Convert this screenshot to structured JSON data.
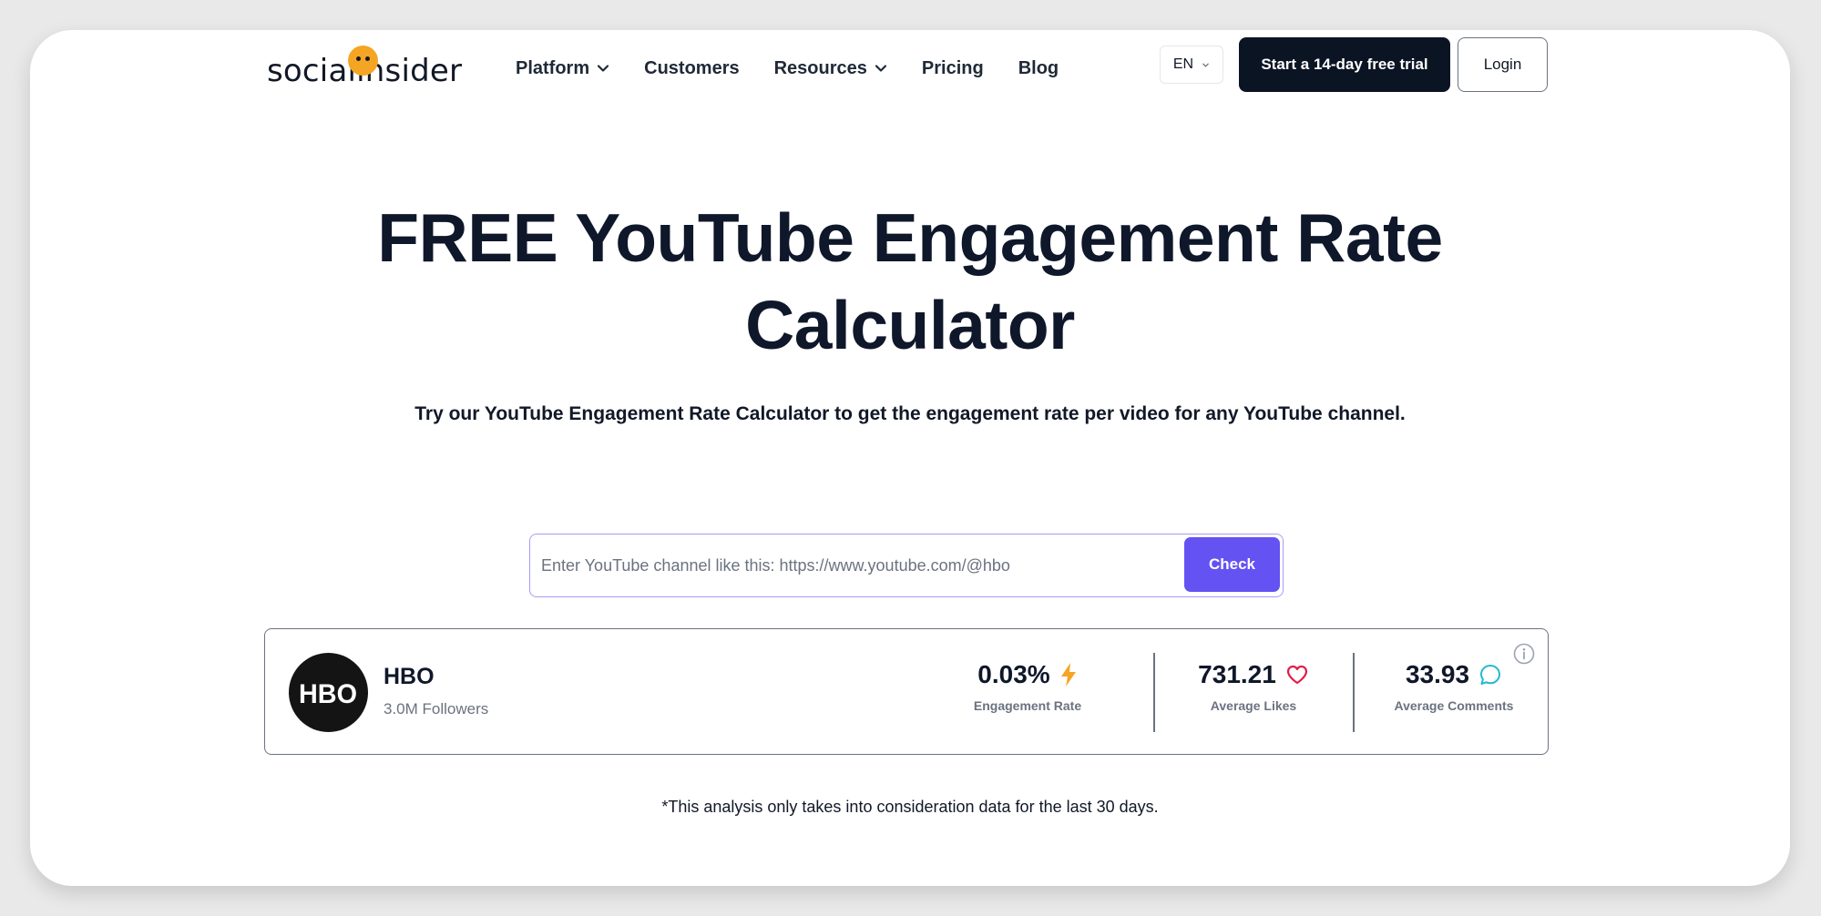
{
  "nav": {
    "logo_text": "socialinsider",
    "items": [
      {
        "label": "Platform",
        "dropdown": true
      },
      {
        "label": "Customers",
        "dropdown": false
      },
      {
        "label": "Resources",
        "dropdown": true
      },
      {
        "label": "Pricing",
        "dropdown": false
      },
      {
        "label": "Blog",
        "dropdown": false
      }
    ],
    "language": "EN",
    "trial_label": "Start a 14-day free trial",
    "login_label": "Login"
  },
  "hero": {
    "title_line1": "FREE YouTube Engagement Rate",
    "title_line2": "Calculator",
    "subtitle": "Try our YouTube Engagement Rate Calculator to get the engagement rate per video for any YouTube channel."
  },
  "search": {
    "placeholder": "Enter YouTube channel like this: https://www.youtube.com/@hbo",
    "value": "",
    "button_label": "Check"
  },
  "result": {
    "avatar_text": "HBO",
    "channel_name": "HBO",
    "followers": "3.0M Followers",
    "metrics": [
      {
        "value": "0.03%",
        "label": "Engagement Rate",
        "icon": "lightning-icon",
        "color": "#f5a524"
      },
      {
        "value": "731.21",
        "label": "Average Likes",
        "icon": "heart-icon",
        "color": "#e11d48"
      },
      {
        "value": "33.93",
        "label": "Average Comments",
        "icon": "comment-icon",
        "color": "#22b8cf"
      }
    ]
  },
  "footnote": "*This analysis only takes into consideration data for the last 30 days.",
  "colors": {
    "primary_dark": "#0b1423",
    "accent_purple": "#6552f2",
    "logo_yellow": "#f5a524"
  }
}
